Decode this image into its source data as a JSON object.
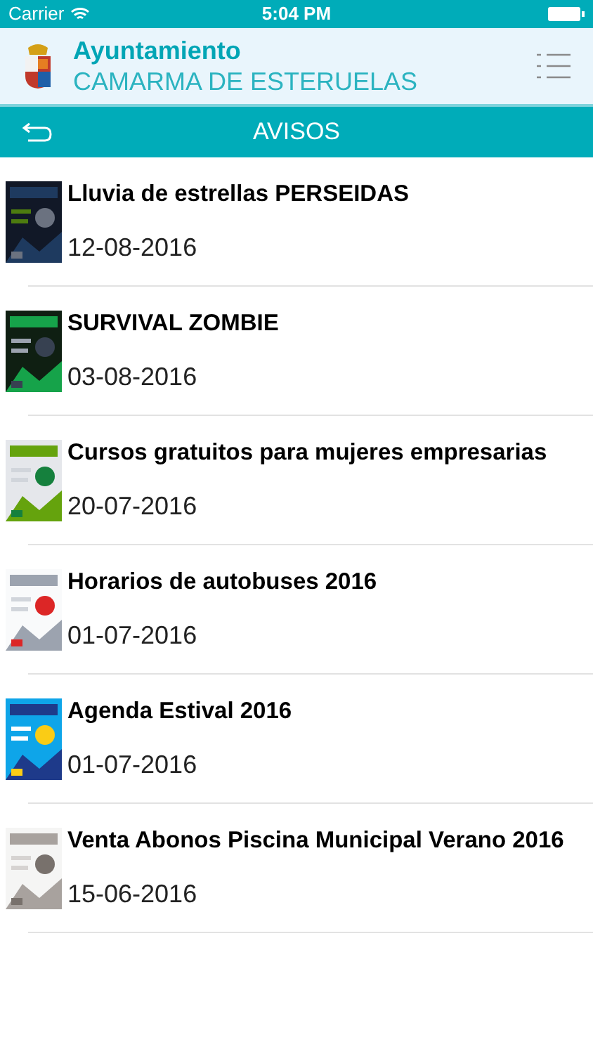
{
  "status_bar": {
    "carrier": "Carrier",
    "time": "5:04 PM"
  },
  "header": {
    "title": "Ayuntamiento",
    "subtitle": "CAMARMA DE ESTERUELAS"
  },
  "nav": {
    "title": "AVISOS"
  },
  "items": [
    {
      "title": "Lluvia de estrellas PERSEIDAS",
      "date": "12-08-2016"
    },
    {
      "title": "SURVIVAL ZOMBIE",
      "date": "03-08-2016"
    },
    {
      "title": "Cursos gratuitos para mujeres empresarias",
      "date": "20-07-2016"
    },
    {
      "title": "Horarios de autobuses 2016",
      "date": "01-07-2016"
    },
    {
      "title": "Agenda Estival 2016",
      "date": "01-07-2016"
    },
    {
      "title": "Venta Abonos Piscina Municipal Verano 2016",
      "date": "15-06-2016"
    }
  ]
}
